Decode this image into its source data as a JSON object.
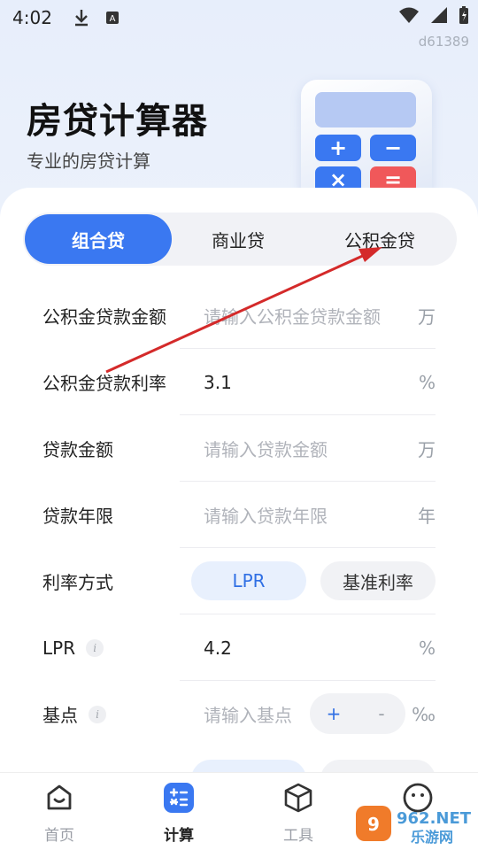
{
  "status": {
    "time": "4:02",
    "device_id": "d61389"
  },
  "header": {
    "title": "房贷计算器",
    "subtitle": "专业的房贷计算"
  },
  "calculator_keys": [
    "+",
    "−",
    "×",
    "="
  ],
  "tabs": [
    {
      "label": "组合贷",
      "active": true
    },
    {
      "label": "商业贷",
      "active": false
    },
    {
      "label": "公积金贷",
      "active": false
    }
  ],
  "form": {
    "fund_amount": {
      "label": "公积金贷款金额",
      "placeholder": "请输入公积金贷款金额",
      "unit": "万"
    },
    "fund_rate": {
      "label": "公积金贷款利率",
      "value": "3.1",
      "unit": "%"
    },
    "loan_amount": {
      "label": "贷款金额",
      "placeholder": "请输入贷款金额",
      "unit": "万"
    },
    "loan_years": {
      "label": "贷款年限",
      "placeholder": "请输入贷款年限",
      "unit": "年"
    },
    "rate_mode": {
      "label": "利率方式",
      "options": [
        "LPR",
        "基准利率"
      ],
      "selected": "LPR"
    },
    "lpr": {
      "label": "LPR",
      "value": "4.2",
      "unit": "%"
    },
    "basis_points": {
      "label": "基点",
      "placeholder": "请输入基点",
      "plus": "+",
      "minus": "-",
      "unit": "‰"
    }
  },
  "bottom_nav": [
    {
      "label": "首页",
      "icon": "home-icon",
      "active": false
    },
    {
      "label": "计算",
      "icon": "calculator-icon",
      "active": true
    },
    {
      "label": "工具",
      "icon": "cube-icon",
      "active": false
    },
    {
      "label": "",
      "icon": "smiley-icon",
      "active": false
    }
  ],
  "watermark": {
    "brand": "962.NET",
    "text": "乐游网"
  },
  "colors": {
    "accent": "#3a78f1",
    "annotation": "#d42a2a",
    "muted": "#9aa0a8"
  }
}
